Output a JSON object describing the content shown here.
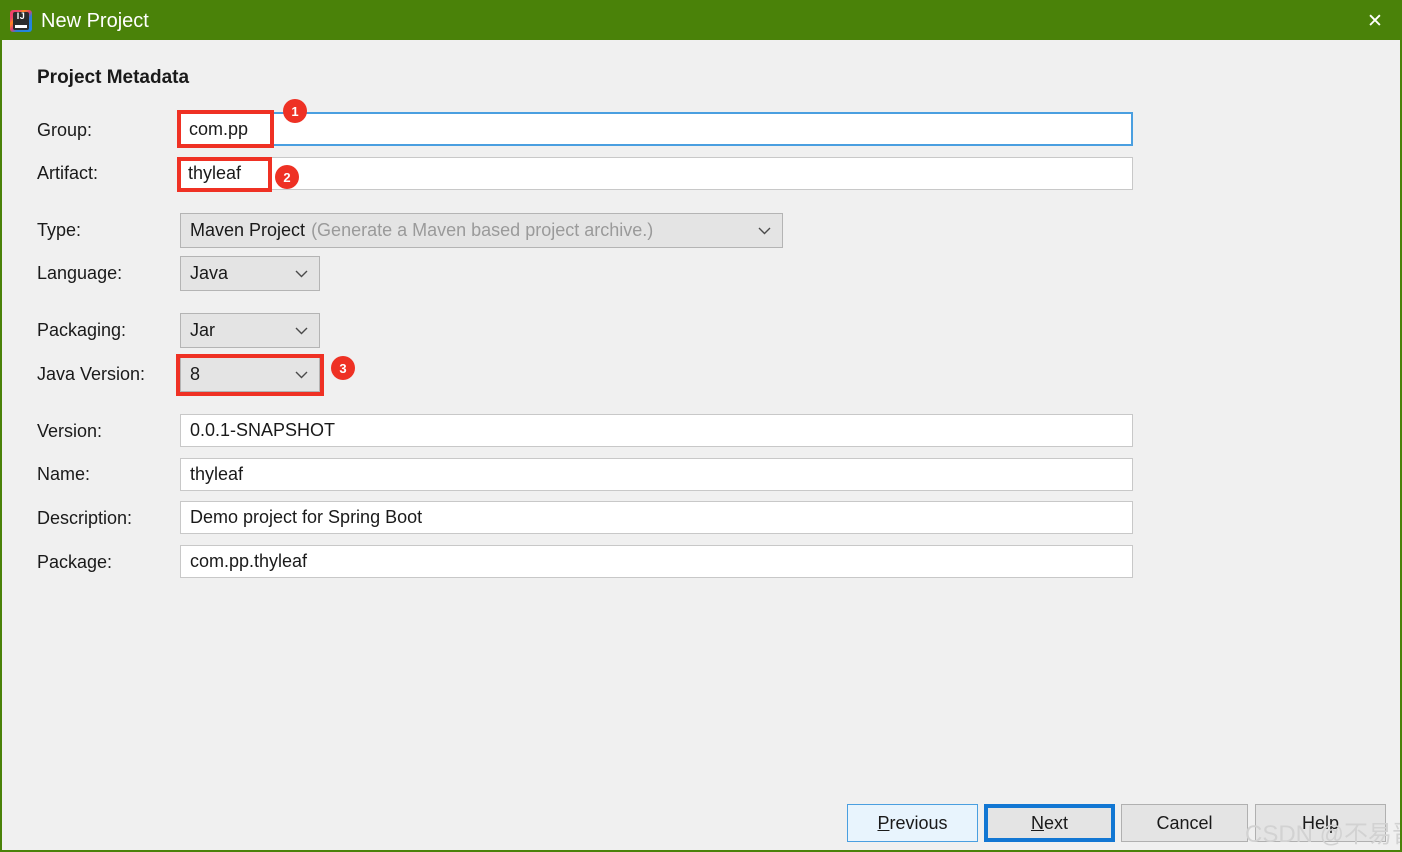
{
  "window": {
    "title": "New Project",
    "app_icon": "intellij-idea-icon",
    "icon_text": "IJ",
    "close_icon": "✕",
    "titlebar_color": "#4a8209",
    "background_color": "#f0f0f0"
  },
  "section": {
    "heading": "Project Metadata"
  },
  "fields": {
    "group": {
      "label": "Group:",
      "value": "com.pp",
      "focused": true
    },
    "artifact": {
      "label": "Artifact:",
      "value": "thyleaf",
      "focused": false
    },
    "type": {
      "label": "Type:",
      "value": "Maven Project",
      "hint": "(Generate a Maven based project archive.)"
    },
    "language": {
      "label": "Language:",
      "value": "Java"
    },
    "packaging": {
      "label": "Packaging:",
      "value": "Jar"
    },
    "java_version": {
      "label": "Java Version:",
      "value": "8"
    },
    "version": {
      "label": "Version:",
      "value": "0.0.1-SNAPSHOT"
    },
    "name": {
      "label": "Name:",
      "value": "thyleaf"
    },
    "description": {
      "label": "Description:",
      "value": "Demo project for Spring Boot"
    },
    "package": {
      "label": "Package:",
      "value": "com.pp.thyleaf"
    }
  },
  "annotations": {
    "accent_color": "#ee3124",
    "badges": [
      {
        "number": "1",
        "target": "group-field"
      },
      {
        "number": "2",
        "target": "artifact-field"
      },
      {
        "number": "3",
        "target": "java-version-combo"
      }
    ]
  },
  "buttons": {
    "previous": {
      "prefix": "",
      "mnemonic": "P",
      "suffix": "revious"
    },
    "next": {
      "prefix": "",
      "mnemonic": "N",
      "suffix": "ext"
    },
    "cancel": {
      "prefix": "Cancel",
      "mnemonic": "",
      "suffix": ""
    },
    "help": {
      "prefix": "Help",
      "mnemonic": "",
      "suffix": ""
    }
  },
  "watermark": {
    "text": "CSDN @不易晋"
  }
}
